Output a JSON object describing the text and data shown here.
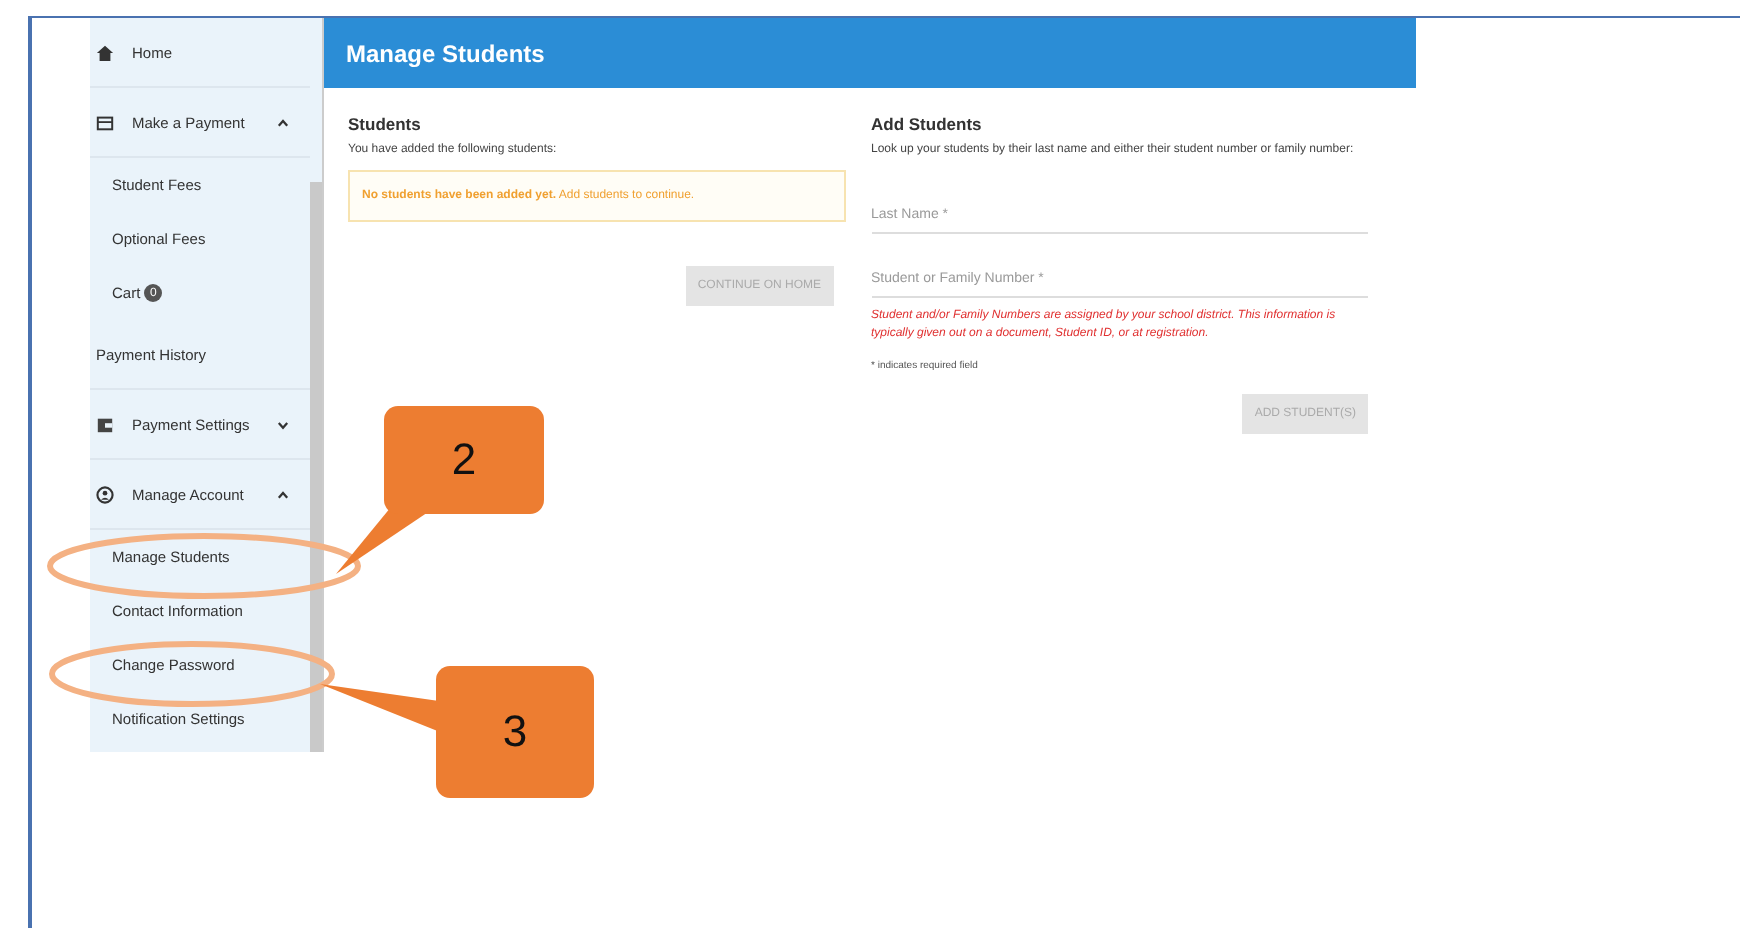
{
  "sidebar": {
    "items": [
      {
        "kind": "section",
        "label": "Home"
      },
      {
        "kind": "section",
        "label": "Make a Payment",
        "expanded": true,
        "children": [
          {
            "label": "Student Fees"
          },
          {
            "label": "Optional Fees"
          },
          {
            "label": "Cart",
            "badge": "0"
          }
        ]
      },
      {
        "kind": "plain",
        "label": "Payment History"
      },
      {
        "kind": "section",
        "label": "Payment Settings",
        "expanded": false
      },
      {
        "kind": "section",
        "label": "Manage Account",
        "expanded": true,
        "children": [
          {
            "label": "Manage Students"
          },
          {
            "label": "Contact Information"
          },
          {
            "label": "Change Password"
          },
          {
            "label": "Notification Settings"
          }
        ]
      }
    ]
  },
  "header": {
    "title": "Manage Students"
  },
  "students": {
    "title": "Students",
    "text": "You have added the following students:",
    "notice": "**No students have been added yet.** Add students to continue.",
    "button": "CONTINUE ON HOME"
  },
  "add_students": {
    "title": "Add Students",
    "text": "Look up your students by their last name and either their student number or family number:",
    "fields": [
      {
        "placeholder": "Last Name *"
      },
      {
        "placeholder": "Student or Family Number *"
      }
    ],
    "hint": "Student and/or Family Numbers are assigned by your school district. This information is typically given out on a document, Student ID, or at registration.",
    "required_note": "* indicates required field",
    "button": "ADD STUDENT(S)"
  },
  "annotations": [
    {
      "label": "2"
    },
    {
      "label": "3"
    }
  ]
}
